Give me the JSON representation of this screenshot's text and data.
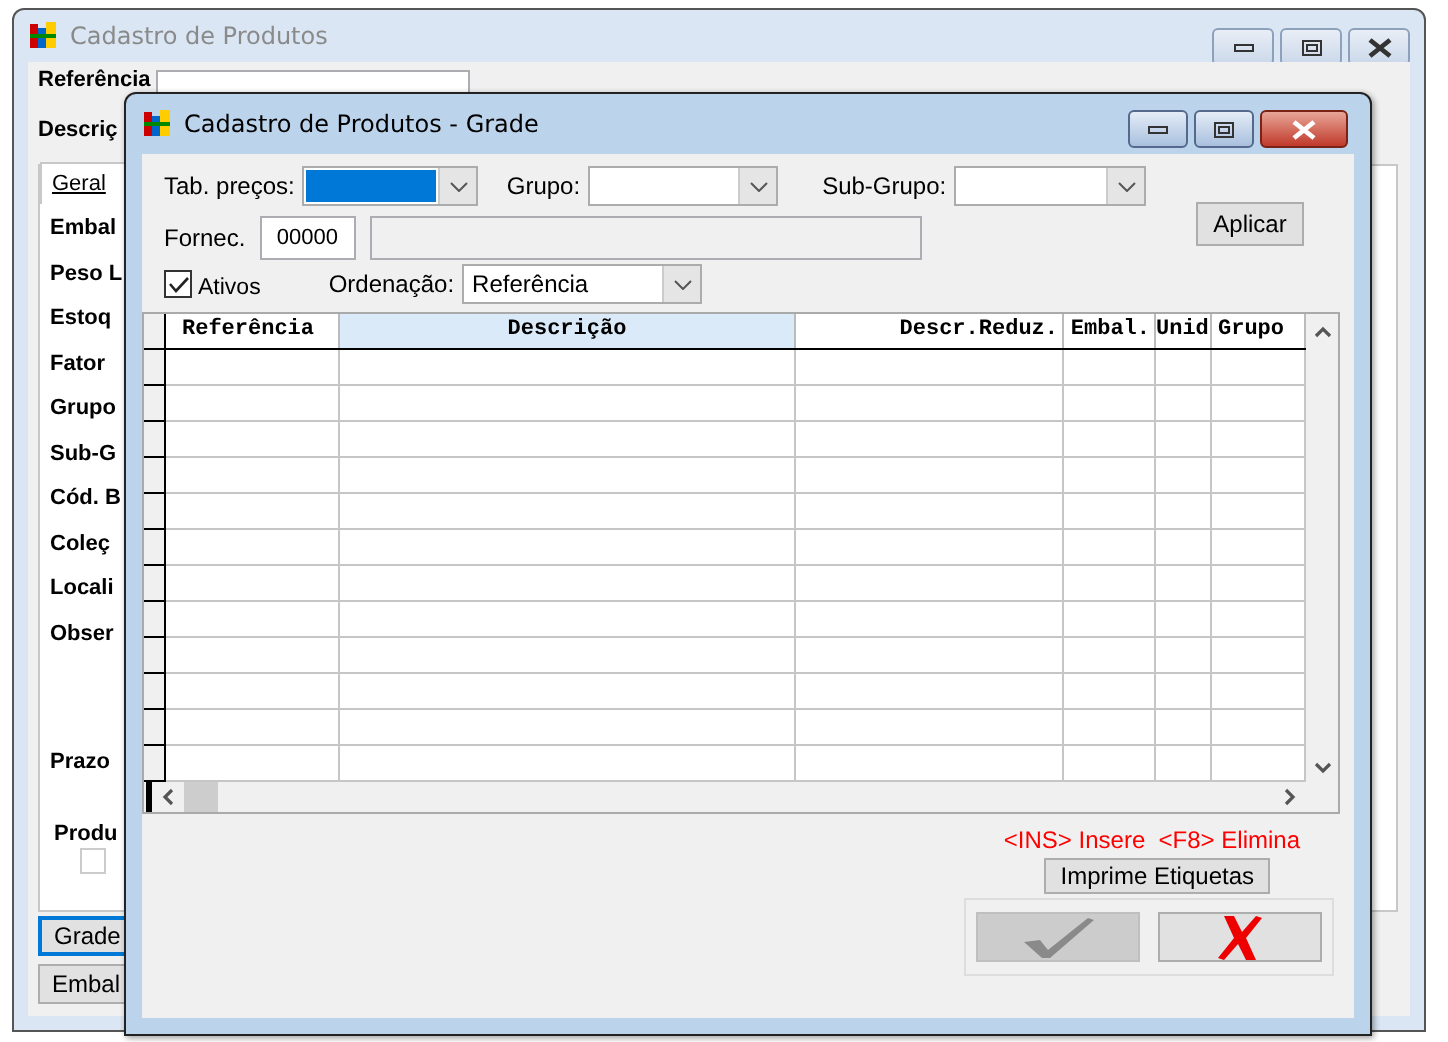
{
  "background_window": {
    "title": "Cadastro de Produtos",
    "active": false,
    "fields": [
      {
        "label": "Referência"
      },
      {
        "label": "Descriç"
      }
    ],
    "tabs": [
      {
        "label": "Geral",
        "selected": true
      }
    ],
    "labels": [
      "Embal",
      "Peso L",
      "Estoq",
      "Fator",
      "Grupo",
      "Sub-G",
      "Cód. B",
      "Coleç",
      "Locali",
      "Obser"
    ],
    "lower_labels": [
      "Prazo",
      "Produ"
    ],
    "checkbox": {
      "checked": false
    },
    "buttons": [
      {
        "label": "Grade",
        "focused": true
      },
      {
        "label": "Embal",
        "focused": false
      }
    ]
  },
  "grade_window": {
    "title": "Cadastro de Produtos - Grade",
    "active": true,
    "tab_precos": {
      "label": "Tab. preços:",
      "selected": true
    },
    "grupo": {
      "label": "Grupo:"
    },
    "sub_grupo": {
      "label": "Sub-Grupo:"
    },
    "apply_button": "Aplicar",
    "fornec": {
      "label": "Fornec.",
      "value": "00000"
    },
    "ativos": {
      "label": "Ativos",
      "checked": true
    },
    "ordenacao": {
      "label": "Ordenação:",
      "value": "Referência"
    },
    "table": {
      "columns": [
        "Referência",
        "Descrição",
        "Descr.Reduz.",
        "Embal.",
        "Unid",
        "Grupo"
      ]
    },
    "hint": "<INS> Insere  <F8> Elimina",
    "print_button": "Imprime Etiquetas",
    "ok_button": {
      "disabled": true
    },
    "cancel_button": {
      "disabled": false
    }
  }
}
